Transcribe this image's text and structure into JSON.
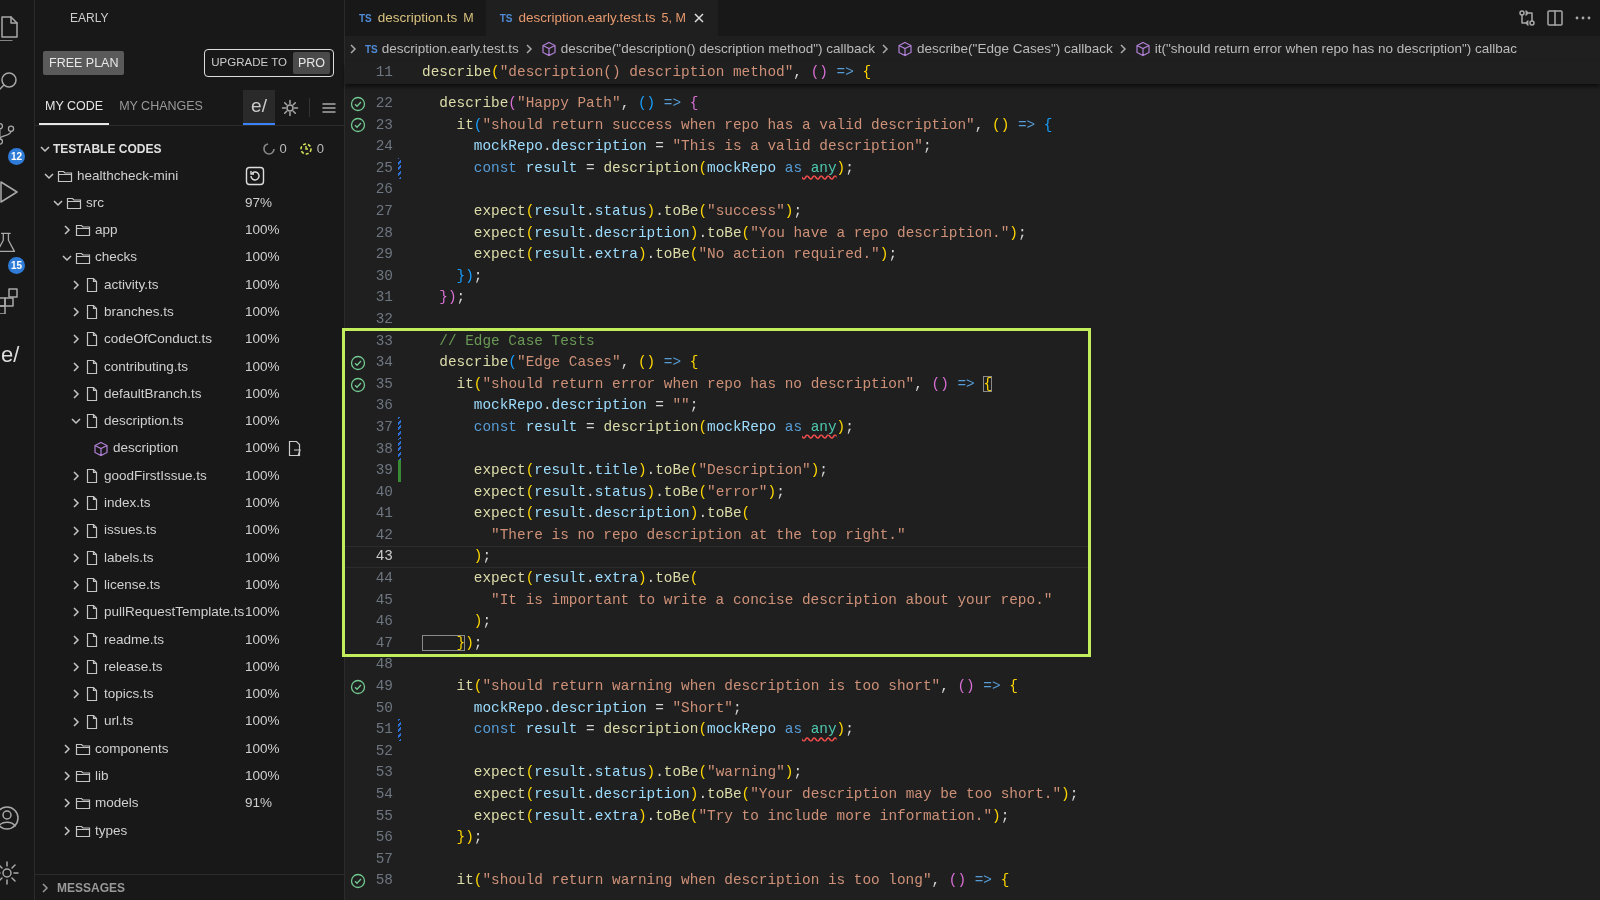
{
  "activity_bar": {
    "top": [
      {
        "kind": "files"
      },
      {
        "kind": "search"
      },
      {
        "kind": "source-control",
        "badge": "12"
      },
      {
        "kind": "run"
      },
      {
        "kind": "flask",
        "badge": "15"
      },
      {
        "kind": "extensions"
      },
      {
        "kind": "logo",
        "label": "e/"
      }
    ],
    "bottom": [
      {
        "kind": "account"
      },
      {
        "kind": "settings"
      }
    ]
  },
  "sidebar": {
    "title": "EARLY",
    "plan": "FREE PLAN",
    "upgrade": {
      "label": "UPGRADE TO",
      "tag": "PRO"
    },
    "tabs": [
      {
        "label": "MY CODE",
        "selected": true
      },
      {
        "label": "MY CHANGES",
        "selected": false
      }
    ],
    "logo_button": {
      "label": "e/",
      "active": true
    },
    "tree": {
      "header": "TESTABLE CODES",
      "expanded": true,
      "counts": [
        {
          "kind": "pending",
          "value": "0"
        },
        {
          "kind": "timer",
          "value": "0"
        }
      ],
      "items": [
        {
          "kind": "project",
          "label": "healthcheck-mini",
          "expanded": true,
          "children": [
            {
              "kind": "folder",
              "label": "src",
              "coverage": "97%",
              "expanded": true,
              "children": [
                {
                  "kind": "folder",
                  "label": "app",
                  "coverage": "100%",
                  "expanded": false
                },
                {
                  "kind": "folder",
                  "label": "checks",
                  "coverage": "100%",
                  "expanded": true,
                  "children": [
                    {
                      "kind": "file",
                      "label": "activity.ts",
                      "coverage": "100%",
                      "expanded": false
                    },
                    {
                      "kind": "file",
                      "label": "branches.ts",
                      "coverage": "100%",
                      "expanded": false
                    },
                    {
                      "kind": "file",
                      "label": "codeOfConduct.ts",
                      "coverage": "100%",
                      "expanded": false
                    },
                    {
                      "kind": "file",
                      "label": "contributing.ts",
                      "coverage": "100%",
                      "expanded": false
                    },
                    {
                      "kind": "file",
                      "label": "defaultBranch.ts",
                      "coverage": "100%",
                      "expanded": false
                    },
                    {
                      "kind": "file",
                      "label": "description.ts",
                      "coverage": "100%",
                      "expanded": true,
                      "children": [
                        {
                          "kind": "symbol",
                          "label": "description",
                          "coverage": "100%"
                        }
                      ]
                    },
                    {
                      "kind": "file",
                      "label": "goodFirstIssue.ts",
                      "coverage": "100%",
                      "expanded": false
                    },
                    {
                      "kind": "file",
                      "label": "index.ts",
                      "coverage": "100%",
                      "expanded": false
                    },
                    {
                      "kind": "file",
                      "label": "issues.ts",
                      "coverage": "100%",
                      "expanded": false
                    },
                    {
                      "kind": "file",
                      "label": "labels.ts",
                      "coverage": "100%",
                      "expanded": false
                    },
                    {
                      "kind": "file",
                      "label": "license.ts",
                      "coverage": "100%",
                      "expanded": false
                    },
                    {
                      "kind": "file",
                      "label": "pullRequestTemplate.ts",
                      "coverage": "100%",
                      "expanded": false
                    },
                    {
                      "kind": "file",
                      "label": "readme.ts",
                      "coverage": "100%",
                      "expanded": false
                    },
                    {
                      "kind": "file",
                      "label": "release.ts",
                      "coverage": "100%",
                      "expanded": false
                    },
                    {
                      "kind": "file",
                      "label": "topics.ts",
                      "coverage": "100%",
                      "expanded": false
                    },
                    {
                      "kind": "file",
                      "label": "url.ts",
                      "coverage": "100%",
                      "expanded": false
                    }
                  ]
                },
                {
                  "kind": "folder",
                  "label": "components",
                  "coverage": "100%",
                  "expanded": false
                },
                {
                  "kind": "folder",
                  "label": "lib",
                  "coverage": "100%",
                  "expanded": false
                },
                {
                  "kind": "folder",
                  "label": "models",
                  "coverage": "91%",
                  "expanded": false
                },
                {
                  "kind": "folder",
                  "label": "types",
                  "expanded": false
                }
              ]
            }
          ]
        }
      ]
    },
    "messages": {
      "label": "MESSAGES",
      "expanded": false
    }
  },
  "editor": {
    "tabs": [
      {
        "icon_label": "TS",
        "label": "description.ts",
        "status": "M",
        "selected": false
      },
      {
        "icon_label": "TS",
        "label": "description.early.test.ts",
        "status": "5, M",
        "selected": true
      }
    ],
    "breadcrumb": [
      {
        "kind": "file",
        "icon_label": "TS",
        "label": "description.early.test.ts"
      },
      {
        "kind": "symbol",
        "label": "describe(\"description() description method\") callback"
      },
      {
        "kind": "symbol",
        "label": "describe(\"Edge Cases\") callback"
      },
      {
        "kind": "symbol",
        "label": "it(\"should return error when repo has no description\") callbac"
      }
    ],
    "sticky": {
      "n": "11",
      "code": [
        {
          "fn": "describe"
        },
        {
          "b1": "("
        },
        {
          "str": "\"description() description method\""
        },
        {
          "pl": ", "
        },
        {
          "b2": "()"
        },
        {
          "op": " => "
        },
        {
          "b1": "{"
        }
      ]
    },
    "blocks": [
      {
        "highlighted": false,
        "lines": [
          {
            "n": "22",
            "passed": true,
            "current": false,
            "code": [
              {
                "fn": "  describe"
              },
              {
                "b2": "("
              },
              {
                "str": "\"Happy Path\""
              },
              {
                "pl": ", "
              },
              {
                "b3": "()"
              },
              {
                "op": " => "
              },
              {
                "b2": "{"
              }
            ]
          },
          {
            "n": "23",
            "passed": true,
            "current": false,
            "code": [
              {
                "fn": "    it"
              },
              {
                "b3": "("
              },
              {
                "str": "\"should return success when repo has a valid description\""
              },
              {
                "pl": ", "
              },
              {
                "b1": "()"
              },
              {
                "op": " => "
              },
              {
                "b3": "{"
              }
            ]
          },
          {
            "n": "24",
            "passed": false,
            "current": false,
            "code": [
              {
                "var": "      mockRepo"
              },
              {
                "pl": "."
              },
              {
                "var": "description"
              },
              {
                "pl": " = "
              },
              {
                "str": "\"This is a valid description\""
              },
              {
                "pl": ";"
              }
            ]
          },
          {
            "n": "25",
            "kind": "modified",
            "passed": false,
            "current": false,
            "code": [
              {
                "kw": "      const"
              },
              {
                "var": " result"
              },
              {
                "pl": " = "
              },
              {
                "fn": "description"
              },
              {
                "b1": "("
              },
              {
                "var": "mockRepo"
              },
              {
                "kw": " as"
              },
              {
                "err": " any"
              },
              {
                "b1": ")"
              },
              {
                "pl": ";"
              }
            ]
          },
          {
            "n": "26",
            "passed": false,
            "current": false
          },
          {
            "n": "27",
            "passed": false,
            "current": false,
            "code": [
              {
                "fn": "      expect"
              },
              {
                "b1": "("
              },
              {
                "var": "result"
              },
              {
                "pl": "."
              },
              {
                "var": "status"
              },
              {
                "b1": ")"
              },
              {
                "pl": "."
              },
              {
                "fn": "toBe"
              },
              {
                "b1": "("
              },
              {
                "str": "\"success\""
              },
              {
                "b1": ")"
              },
              {
                "pl": ";"
              }
            ]
          },
          {
            "n": "28",
            "passed": false,
            "current": false,
            "code": [
              {
                "fn": "      expect"
              },
              {
                "b1": "("
              },
              {
                "var": "result"
              },
              {
                "pl": "."
              },
              {
                "var": "description"
              },
              {
                "b1": ")"
              },
              {
                "pl": "."
              },
              {
                "fn": "toBe"
              },
              {
                "b1": "("
              },
              {
                "str": "\"You have a repo description.\""
              },
              {
                "b1": ")"
              },
              {
                "pl": ";"
              }
            ]
          },
          {
            "n": "29",
            "passed": false,
            "current": false,
            "code": [
              {
                "fn": "      expect"
              },
              {
                "b1": "("
              },
              {
                "var": "result"
              },
              {
                "pl": "."
              },
              {
                "var": "extra"
              },
              {
                "b1": ")"
              },
              {
                "pl": "."
              },
              {
                "fn": "toBe"
              },
              {
                "b1": "("
              },
              {
                "str": "\"No action required.\""
              },
              {
                "b1": ")"
              },
              {
                "pl": ";"
              }
            ]
          },
          {
            "n": "30",
            "passed": false,
            "current": false,
            "code": [
              {
                "b3": "    })"
              },
              {
                "pl": ";"
              }
            ]
          },
          {
            "n": "31",
            "passed": false,
            "current": false,
            "code": [
              {
                "b2": "  })"
              },
              {
                "pl": ";"
              }
            ]
          },
          {
            "n": "32",
            "passed": false,
            "current": false
          }
        ]
      },
      {
        "highlighted": true,
        "lines": [
          {
            "n": "33",
            "passed": false,
            "current": false,
            "code": [
              {
                "cmt": "  // Edge Case Tests"
              }
            ]
          },
          {
            "n": "34",
            "passed": true,
            "current": false,
            "code": [
              {
                "fn": "  describe"
              },
              {
                "b3": "("
              },
              {
                "str": "\"Edge Cases\""
              },
              {
                "pl": ", "
              },
              {
                "b1": "()"
              },
              {
                "op": " => "
              },
              {
                "b1": "{"
              }
            ]
          },
          {
            "n": "35",
            "passed": true,
            "current": false,
            "code": [
              {
                "fn": "    it"
              },
              {
                "b1": "("
              },
              {
                "str": "\"should return error when repo has no description\""
              },
              {
                "pl": ", "
              },
              {
                "b2": "()"
              },
              {
                "op": " => "
              },
              {
                "match": "{"
              }
            ]
          },
          {
            "n": "36",
            "passed": false,
            "current": false,
            "code": [
              {
                "var": "      mockRepo"
              },
              {
                "pl": "."
              },
              {
                "var": "description"
              },
              {
                "pl": " = "
              },
              {
                "str": "\"\""
              },
              {
                "pl": ";"
              }
            ]
          },
          {
            "n": "37",
            "kind": "modified",
            "passed": false,
            "current": false,
            "code": [
              {
                "kw": "      const"
              },
              {
                "var": " result"
              },
              {
                "pl": " = "
              },
              {
                "fn": "description"
              },
              {
                "b1": "("
              },
              {
                "var": "mockRepo"
              },
              {
                "kw": " as"
              },
              {
                "err": " any"
              },
              {
                "b1": ")"
              },
              {
                "pl": ";"
              }
            ]
          },
          {
            "n": "38",
            "kind": "modified",
            "passed": false,
            "current": false
          },
          {
            "n": "39",
            "kind": "added",
            "passed": false,
            "current": false,
            "code": [
              {
                "fn": "      expect"
              },
              {
                "b1": "("
              },
              {
                "var": "result"
              },
              {
                "pl": "."
              },
              {
                "var": "title"
              },
              {
                "b1": ")"
              },
              {
                "pl": "."
              },
              {
                "fn": "toBe"
              },
              {
                "b1": "("
              },
              {
                "str": "\"Description\""
              },
              {
                "b1": ")"
              },
              {
                "pl": ";"
              }
            ]
          },
          {
            "n": "40",
            "passed": false,
            "current": false,
            "code": [
              {
                "fn": "      expect"
              },
              {
                "b1": "("
              },
              {
                "var": "result"
              },
              {
                "pl": "."
              },
              {
                "var": "status"
              },
              {
                "b1": ")"
              },
              {
                "pl": "."
              },
              {
                "fn": "toBe"
              },
              {
                "b1": "("
              },
              {
                "str": "\"error\""
              },
              {
                "b1": ")"
              },
              {
                "pl": ";"
              }
            ]
          },
          {
            "n": "41",
            "passed": false,
            "current": false,
            "code": [
              {
                "fn": "      expect"
              },
              {
                "b1": "("
              },
              {
                "var": "result"
              },
              {
                "pl": "."
              },
              {
                "var": "description"
              },
              {
                "b1": ")"
              },
              {
                "pl": "."
              },
              {
                "fn": "toBe"
              },
              {
                "b1": "("
              }
            ]
          },
          {
            "n": "42",
            "passed": false,
            "current": false,
            "code": [
              {
                "str": "        \"There is no repo description at the top right.\""
              }
            ]
          },
          {
            "n": "43",
            "passed": false,
            "current": true,
            "code": [
              {
                "b1": "      )"
              },
              {
                "pl": ";"
              }
            ]
          },
          {
            "n": "44",
            "passed": false,
            "current": false,
            "code": [
              {
                "fn": "      expect"
              },
              {
                "b1": "("
              },
              {
                "var": "result"
              },
              {
                "pl": "."
              },
              {
                "var": "extra"
              },
              {
                "b1": ")"
              },
              {
                "pl": "."
              },
              {
                "fn": "toBe"
              },
              {
                "b1": "("
              }
            ]
          },
          {
            "n": "45",
            "passed": false,
            "current": false,
            "code": [
              {
                "str": "        \"It is important to write a concise description about your repo.\""
              }
            ]
          },
          {
            "n": "46",
            "passed": false,
            "current": false,
            "code": [
              {
                "b1": "      )"
              },
              {
                "pl": ";"
              }
            ]
          },
          {
            "n": "47",
            "passed": false,
            "current": false,
            "code": [
              {
                "match": "    }"
              },
              {
                "b1": ")"
              },
              {
                "pl": ";"
              }
            ]
          }
        ]
      },
      {
        "highlighted": false,
        "lines": [
          {
            "n": "48",
            "passed": false,
            "current": false
          },
          {
            "n": "49",
            "passed": true,
            "current": false,
            "code": [
              {
                "fn": "    it"
              },
              {
                "b1": "("
              },
              {
                "str": "\"should return warning when description is too short\""
              },
              {
                "pl": ", "
              },
              {
                "b2": "()"
              },
              {
                "op": " => "
              },
              {
                "b1": "{"
              }
            ]
          },
          {
            "n": "50",
            "passed": false,
            "current": false,
            "code": [
              {
                "var": "      mockRepo"
              },
              {
                "pl": "."
              },
              {
                "var": "description"
              },
              {
                "pl": " = "
              },
              {
                "str": "\"Short\""
              },
              {
                "pl": ";"
              }
            ]
          },
          {
            "n": "51",
            "kind": "modified",
            "passed": false,
            "current": false,
            "code": [
              {
                "kw": "      const"
              },
              {
                "var": " result"
              },
              {
                "pl": " = "
              },
              {
                "fn": "description"
              },
              {
                "b1": "("
              },
              {
                "var": "mockRepo"
              },
              {
                "kw": " as"
              },
              {
                "err": " any"
              },
              {
                "b1": ")"
              },
              {
                "pl": ";"
              }
            ]
          },
          {
            "n": "52",
            "passed": false,
            "current": false
          },
          {
            "n": "53",
            "passed": false,
            "current": false,
            "code": [
              {
                "fn": "      expect"
              },
              {
                "b1": "("
              },
              {
                "var": "result"
              },
              {
                "pl": "."
              },
              {
                "var": "status"
              },
              {
                "b1": ")"
              },
              {
                "pl": "."
              },
              {
                "fn": "toBe"
              },
              {
                "b1": "("
              },
              {
                "str": "\"warning\""
              },
              {
                "b1": ")"
              },
              {
                "pl": ";"
              }
            ]
          },
          {
            "n": "54",
            "passed": false,
            "current": false,
            "code": [
              {
                "fn": "      expect"
              },
              {
                "b1": "("
              },
              {
                "var": "result"
              },
              {
                "pl": "."
              },
              {
                "var": "description"
              },
              {
                "b1": ")"
              },
              {
                "pl": "."
              },
              {
                "fn": "toBe"
              },
              {
                "b1": "("
              },
              {
                "str": "\"Your description may be too short.\""
              },
              {
                "b1": ")"
              },
              {
                "pl": ";"
              }
            ]
          },
          {
            "n": "55",
            "passed": false,
            "current": false,
            "code": [
              {
                "fn": "      expect"
              },
              {
                "b1": "("
              },
              {
                "var": "result"
              },
              {
                "pl": "."
              },
              {
                "var": "extra"
              },
              {
                "b1": ")"
              },
              {
                "pl": "."
              },
              {
                "fn": "toBe"
              },
              {
                "b1": "("
              },
              {
                "str": "\"Try to include more information.\""
              },
              {
                "b1": ")"
              },
              {
                "pl": ";"
              }
            ]
          },
          {
            "n": "56",
            "passed": false,
            "current": false,
            "code": [
              {
                "b1": "    })"
              },
              {
                "pl": ";"
              }
            ]
          },
          {
            "n": "57",
            "passed": false,
            "current": false
          },
          {
            "n": "58",
            "passed": true,
            "current": false,
            "code": [
              {
                "fn": "    it"
              },
              {
                "b1": "("
              },
              {
                "str": "\"should return warning when description is too long\""
              },
              {
                "pl": ", "
              },
              {
                "b2": "()"
              },
              {
                "op": " => "
              },
              {
                "b1": "{"
              }
            ]
          }
        ]
      }
    ]
  }
}
